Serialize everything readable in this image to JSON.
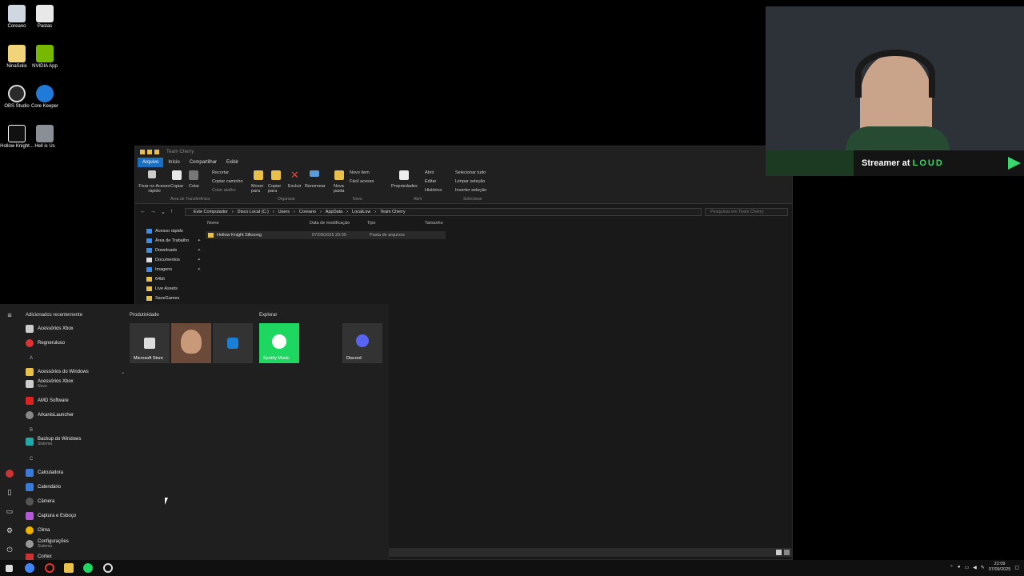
{
  "desktop_icons": [
    {
      "label": "Coreano"
    },
    {
      "label": "Pastas"
    },
    {
      "label": "NinaSolis"
    },
    {
      "label": "NVIDIA App"
    },
    {
      "label": "OBS Studio"
    },
    {
      "label": "Core Keeper"
    },
    {
      "label": "Hollow Knight..."
    },
    {
      "label": "Hell is Us"
    }
  ],
  "explorer": {
    "window_title": "Team Cherry",
    "tabs": [
      "Arquivo",
      "Início",
      "Compartilhar",
      "Exibir"
    ],
    "ribbon": {
      "pin": "Fixar no Acesso rápido",
      "copy": "Copiar",
      "paste": "Colar",
      "cut": "Recortar",
      "copy_path": "Copiar caminho",
      "paste_shortcut": "Colar atalho",
      "move_to": "Mover para",
      "copy_to": "Copiar para",
      "delete": "Excluir",
      "rename": "Renomear",
      "new_folder": "Nova pasta",
      "new_item": "Novo item",
      "easy_access": "Fácil acesso",
      "properties": "Propriedades",
      "open": "Abrir",
      "edit": "Editar",
      "history": "Histórico",
      "select_all": "Selecionar tudo",
      "select_none": "Limpar seleção",
      "invert_selection": "Inverter seleção",
      "group_clipboard": "Área de Transferência",
      "group_organize": "Organizar",
      "group_new": "Novo",
      "group_open": "Abrir",
      "group_select": "Selecionar"
    },
    "breadcrumb": [
      "Este Computador",
      "Disco Local (C:)",
      "Users",
      "Coreano",
      "AppData",
      "LocalLow",
      "Team Cherry"
    ],
    "search_placeholder": "Pesquisar em Team Cherry",
    "nav_items": [
      {
        "label": "Acesso rápido",
        "pinned": ""
      },
      {
        "label": "Área de Trabalho",
        "pinned": "✦"
      },
      {
        "label": "Downloads",
        "pinned": "✦"
      },
      {
        "label": "Documentos",
        "pinned": "✦"
      },
      {
        "label": "Imagens",
        "pinned": "✦"
      },
      {
        "label": "64bit",
        "pinned": ""
      },
      {
        "label": "Live Assets",
        "pinned": ""
      },
      {
        "label": "SaveGames",
        "pinned": ""
      }
    ],
    "columns": [
      "Nome",
      "Data de modificação",
      "Tipo",
      "Tamanho"
    ],
    "rows": [
      {
        "name": "Hollow Knight Silksong",
        "modified": "07/09/2025 20:00",
        "type": "Pasta de arquivos",
        "size": ""
      }
    ]
  },
  "start_menu": {
    "recent_header": "Adicionados recentemente",
    "apps": [
      {
        "label": "Acessórios Xbox",
        "sub": ""
      },
      {
        "label": "Regneruluso",
        "sub": ""
      },
      {
        "letter": "A"
      },
      {
        "label": "Acessórios do Windows",
        "sub": ""
      },
      {
        "label": "Acessórios Xbox",
        "sub": "Novo"
      },
      {
        "label": "AMD Software",
        "sub": ""
      },
      {
        "label": "ArkanisLauncher",
        "sub": ""
      },
      {
        "letter": "B"
      },
      {
        "label": "Backup do Windows",
        "sub": "Sistema"
      },
      {
        "letter": "C"
      },
      {
        "label": "Calculadora",
        "sub": ""
      },
      {
        "label": "Calendário",
        "sub": ""
      },
      {
        "label": "Câmera",
        "sub": ""
      },
      {
        "label": "Captura e Esboço",
        "sub": ""
      },
      {
        "label": "Clima",
        "sub": ""
      },
      {
        "label": "Configurações",
        "sub": "Sistema"
      },
      {
        "label": "Cortex",
        "sub": ""
      }
    ],
    "groups": [
      "Produtividade",
      "Explorar"
    ],
    "tiles": [
      {
        "label": "Microsoft Store"
      },
      {
        "label": ""
      },
      {
        "label": ""
      },
      {
        "label": "Spotify Music"
      },
      {
        "label": "Discord"
      }
    ]
  },
  "taskbar": {
    "time": "22:09",
    "date": "07/09/2025"
  },
  "webcam_banner": {
    "text": "Streamer at ",
    "brand": "LOUD"
  },
  "colors": {
    "accent": "#1a6fc1",
    "folder": "#e8c04a",
    "spotify": "#1ed760",
    "discord": "#5865f2",
    "loud_green": "#39d86c"
  }
}
